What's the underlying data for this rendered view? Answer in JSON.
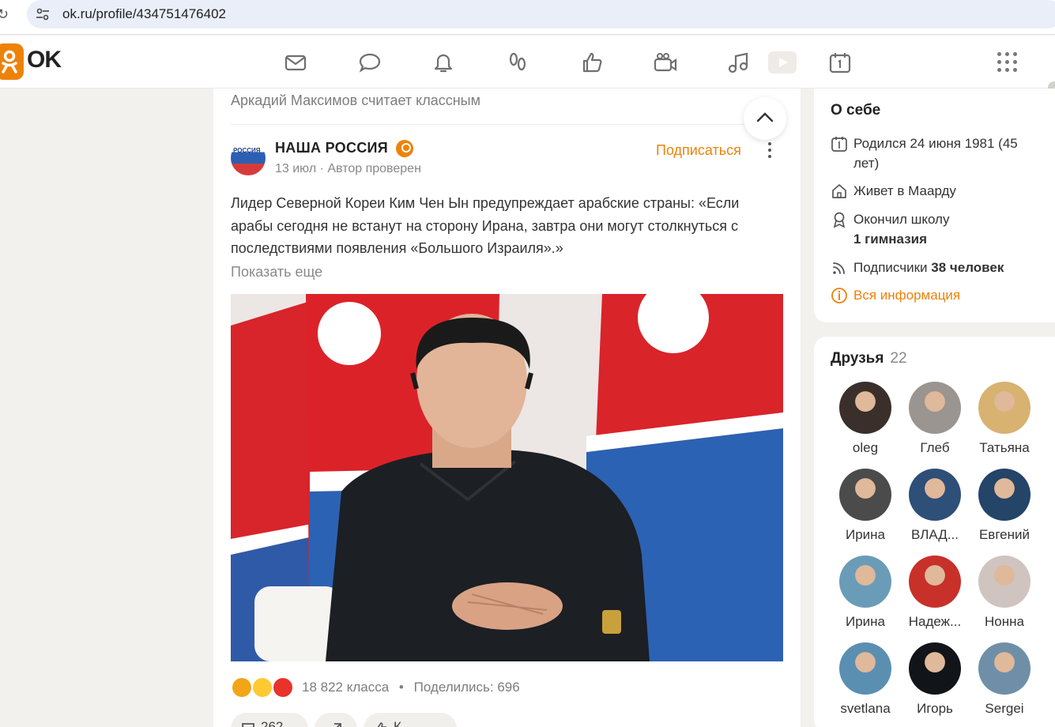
{
  "browser": {
    "url": "ok.ru/profile/434751476402"
  },
  "header": {
    "logo_text": "OK",
    "nav": [
      "mail-icon",
      "chat-icon",
      "bell-icon",
      "footprints-icon",
      "like-icon",
      "camera-icon",
      "music-icon",
      "video-icon",
      "calendar-icon"
    ],
    "apps": "apps-grid-icon"
  },
  "feed": {
    "liked_line": "Аркадий Максимов считает классным",
    "post": {
      "group_name": "НАША РОССИЯ",
      "meta": "13 июл · Автор проверен",
      "subscribe_label": "Подписаться",
      "text": "Лидер Северной Кореи Ким Чен Ын предупреждает арабские страны: «Если арабы сегодня не встанут на сторону Ирана, завтра они могут столкнуться с последствиями появления «Большого Израиля».»",
      "show_more": "Показать еще",
      "likes": "18 822 класса",
      "separator": "•",
      "shares": "Поделились: 696",
      "actions": [
        "262",
        "",
        "К..."
      ]
    }
  },
  "about": {
    "title": "О себе",
    "born": "Родился 24 июня 1981 (45 лет)",
    "lives": "Живет в Маарду",
    "school_label": "Окончил школу",
    "school_name": "1 гимназия",
    "subs_label": "Подписчики",
    "subs_count": "38 человек",
    "all_info": "Вся информация"
  },
  "friends": {
    "title": "Друзья",
    "count": "22",
    "list": [
      {
        "name": "oleg"
      },
      {
        "name": "Глеб"
      },
      {
        "name": "Татьяна"
      },
      {
        "name": "Ирина"
      },
      {
        "name": "ВЛАД..."
      },
      {
        "name": "Евгений"
      },
      {
        "name": "Ирина"
      },
      {
        "name": "Надеж..."
      },
      {
        "name": "Нонна"
      },
      {
        "name": "svetlana"
      },
      {
        "name": "Игорь"
      },
      {
        "name": "Sergei"
      }
    ]
  },
  "colors": {
    "accent": "#ee8208",
    "page_bg": "#f3f1ee"
  }
}
